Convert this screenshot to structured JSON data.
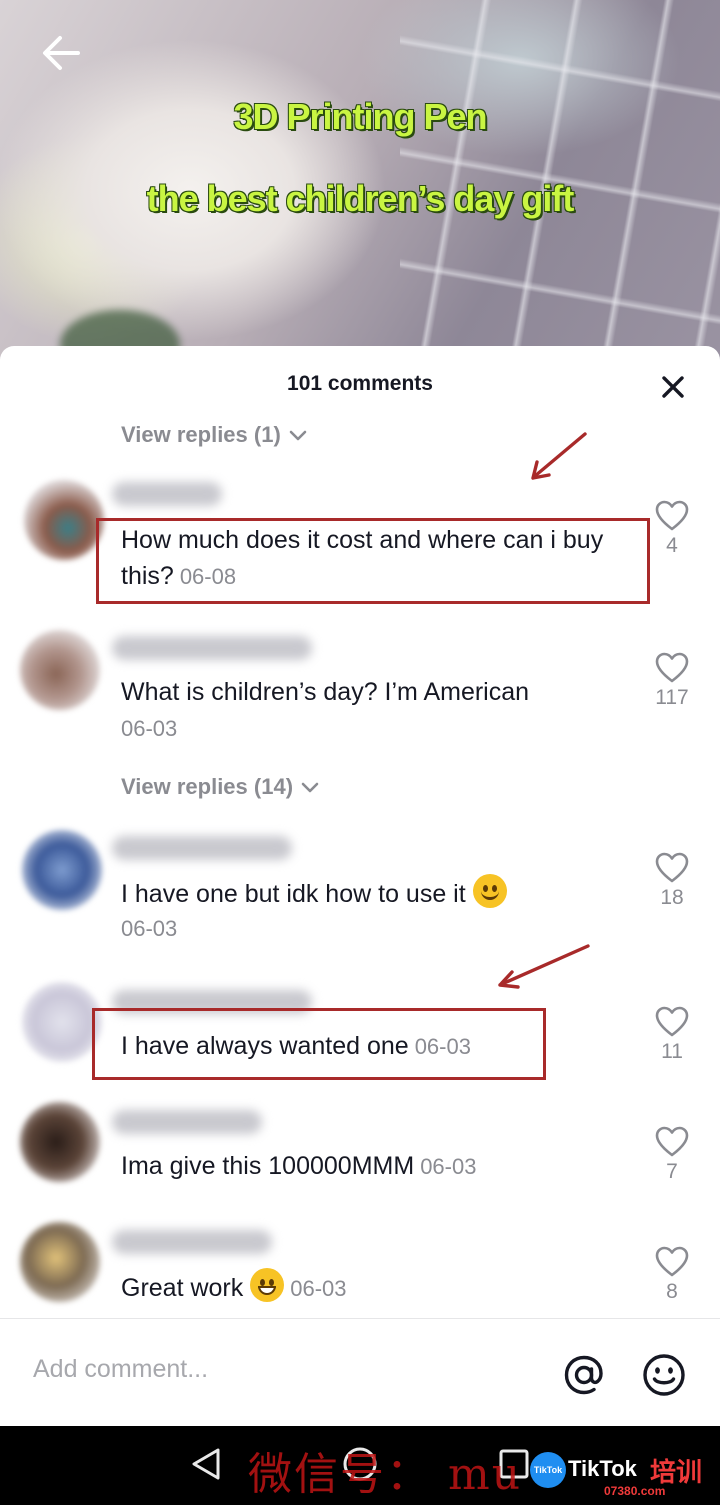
{
  "video": {
    "overlay_line1": "3D Printing Pen",
    "overlay_line2": "the best children’s day gift"
  },
  "sheet": {
    "title": "101 comments"
  },
  "replies": [
    {
      "label": "View replies (1)"
    },
    {
      "label": "View replies (14)"
    }
  ],
  "comments": [
    {
      "text": "How much does it cost and where can i buy this?",
      "date": "06-08",
      "likes": "4",
      "highlighted": true
    },
    {
      "text": "What is children’s day? I’m American",
      "date": "06-03",
      "likes": "117"
    },
    {
      "text": "I have one but idk how to use it",
      "emoji": "slightly-smiling-face",
      "date": "06-03",
      "likes": "18"
    },
    {
      "text": "I have always wanted one",
      "date": "06-03",
      "likes": "11",
      "highlighted": true
    },
    {
      "text": "Ima give this 100000MMM",
      "date": "06-03",
      "likes": "7"
    },
    {
      "text": "Great work",
      "emoji": "grinning-face",
      "date": "06-03",
      "likes": "8"
    }
  ],
  "input": {
    "placeholder": "Add comment..."
  },
  "watermark": {
    "text": "微信号： mu",
    "brand": "TikTok",
    "logo": "TikTok",
    "cn": "培训",
    "url": "07380.com"
  },
  "colors": {
    "highlight": "#a82a2a",
    "overlay_text": "#c9f542"
  }
}
